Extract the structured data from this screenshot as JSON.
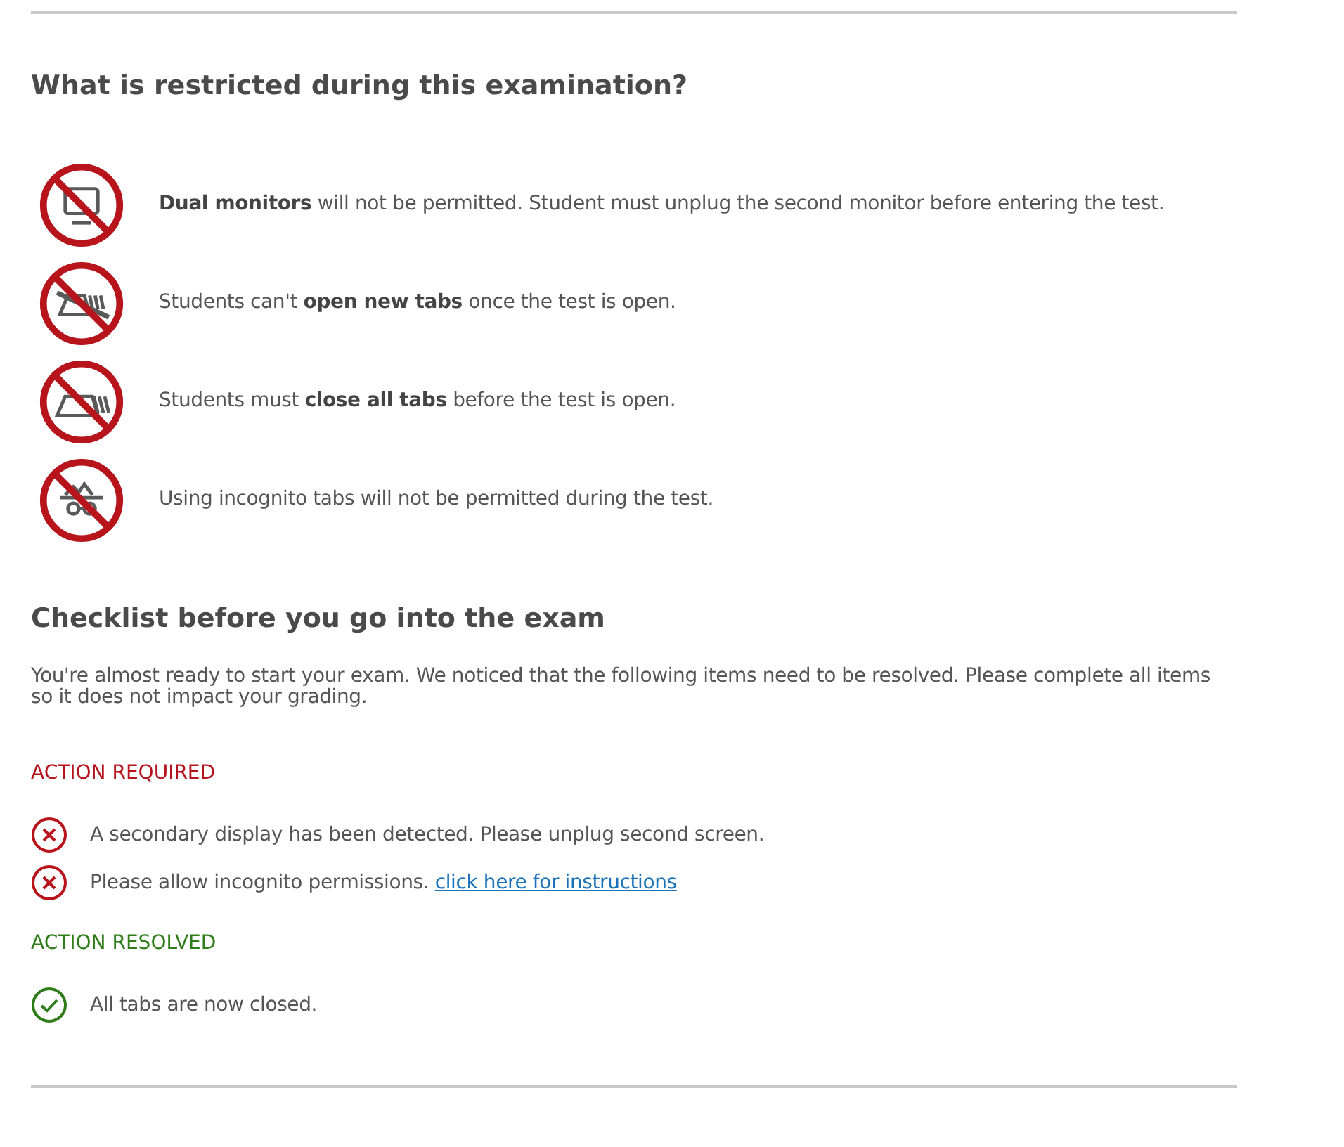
{
  "restrictions": {
    "heading": "What is restricted during this examination?",
    "items": [
      {
        "kind": "monitor",
        "text": "**Dual monitors** will not be permitted. Student must unplug the second monitor before entering the test."
      },
      {
        "kind": "new-tab",
        "text": "Students can't **open new tabs** once the test is open."
      },
      {
        "kind": "tabs",
        "text": "Students must **close all tabs** before the test is open."
      },
      {
        "kind": "incognito",
        "text": "Using incognito tabs will not be permitted during the test."
      }
    ]
  },
  "checklist": {
    "heading": "Checklist before you go into the exam",
    "intro": "You're almost ready to start your exam. We noticed that the following items need to be resolved. Please complete all items so it does not impact your grading.",
    "groups": [
      {
        "kind": "required",
        "label": "ACTION REQUIRED",
        "items": [
          {
            "text": "A secondary display has been detected. Please unplug second screen."
          },
          {
            "text": "Please allow incognito permissions.",
            "link": "click here for instructions"
          }
        ]
      },
      {
        "kind": "resolved",
        "label": "ACTION RESOLVED",
        "items": [
          {
            "text": "All tabs are now closed."
          }
        ]
      }
    ]
  }
}
